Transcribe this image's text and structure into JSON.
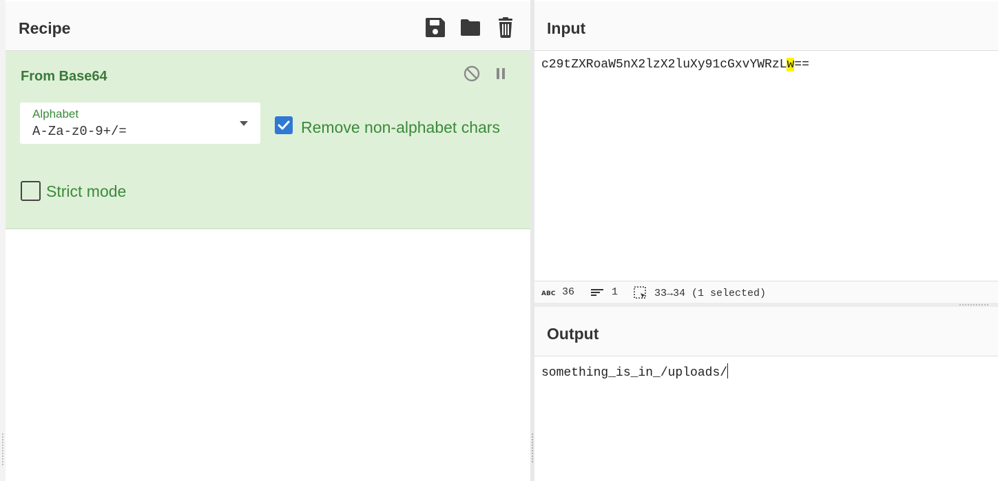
{
  "recipe": {
    "title": "Recipe",
    "icons": [
      "save-icon",
      "folder-icon",
      "trash-icon"
    ]
  },
  "operation": {
    "title": "From Base64",
    "alphabet_label": "Alphabet",
    "alphabet_value": "A-Za-z0-9+/=",
    "remove_non_alphabet": {
      "label": "Remove non-alphabet chars",
      "checked": true
    },
    "strict_mode": {
      "label": "Strict mode",
      "checked": false
    }
  },
  "input": {
    "title": "Input",
    "text_before": "c29tZXRoaW5nX2lzX2luXy91cGxvYWRzL",
    "text_selected": "w",
    "text_after": "==",
    "status": {
      "length": "36",
      "lines": "1",
      "selection": "33→34 (1 selected)"
    }
  },
  "output": {
    "title": "Output",
    "text": "something_is_in_/uploads/"
  },
  "colors": {
    "operation_bg": "#dff0d8",
    "operation_text": "#3a7a3a",
    "checkbox_checked": "#2f78d3",
    "selection_highlight": "#fff200"
  }
}
